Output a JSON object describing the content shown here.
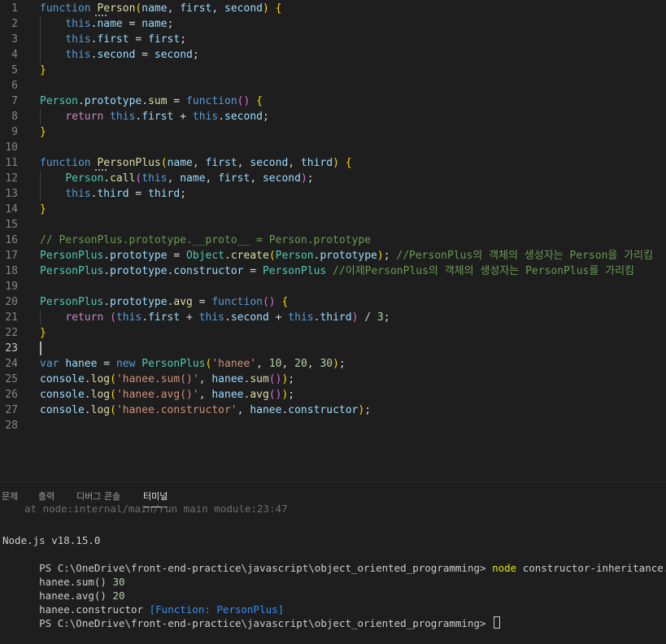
{
  "editor": {
    "lines": [
      {
        "n": "1",
        "tokens": [
          [
            "function",
            "kw"
          ],
          [
            " ",
            "pun"
          ],
          [
            "Person",
            "fn"
          ],
          [
            "(",
            "br1"
          ],
          [
            "name",
            "var"
          ],
          [
            ", ",
            "pun"
          ],
          [
            "first",
            "var"
          ],
          [
            ", ",
            "pun"
          ],
          [
            "second",
            "var"
          ],
          [
            ")",
            "br1"
          ],
          [
            " ",
            "pun"
          ],
          [
            "{",
            "br1"
          ]
        ]
      },
      {
        "n": "2",
        "tokens": [
          [
            "    ",
            "pun"
          ],
          [
            "this",
            "kw"
          ],
          [
            ".",
            "pun"
          ],
          [
            "name",
            "var"
          ],
          [
            " = ",
            "pun"
          ],
          [
            "name",
            "var"
          ],
          [
            ";",
            "pun"
          ]
        ]
      },
      {
        "n": "3",
        "tokens": [
          [
            "    ",
            "pun"
          ],
          [
            "this",
            "kw"
          ],
          [
            ".",
            "pun"
          ],
          [
            "first",
            "var"
          ],
          [
            " = ",
            "pun"
          ],
          [
            "first",
            "var"
          ],
          [
            ";",
            "pun"
          ]
        ]
      },
      {
        "n": "4",
        "tokens": [
          [
            "    ",
            "pun"
          ],
          [
            "this",
            "kw"
          ],
          [
            ".",
            "pun"
          ],
          [
            "second",
            "var"
          ],
          [
            " = ",
            "pun"
          ],
          [
            "second",
            "var"
          ],
          [
            ";",
            "pun"
          ]
        ]
      },
      {
        "n": "5",
        "tokens": [
          [
            "}",
            "br1"
          ]
        ]
      },
      {
        "n": "6",
        "tokens": []
      },
      {
        "n": "7",
        "tokens": [
          [
            "Person",
            "cls"
          ],
          [
            ".",
            "pun"
          ],
          [
            "prototype",
            "var"
          ],
          [
            ".",
            "pun"
          ],
          [
            "sum",
            "fn"
          ],
          [
            " = ",
            "pun"
          ],
          [
            "function",
            "kw"
          ],
          [
            "()",
            "br2"
          ],
          [
            " ",
            "pun"
          ],
          [
            "{",
            "br1"
          ]
        ]
      },
      {
        "n": "8",
        "tokens": [
          [
            "    ",
            "pun"
          ],
          [
            "return",
            "ctl"
          ],
          [
            " ",
            "pun"
          ],
          [
            "this",
            "kw"
          ],
          [
            ".",
            "pun"
          ],
          [
            "first",
            "var"
          ],
          [
            " + ",
            "pun"
          ],
          [
            "this",
            "kw"
          ],
          [
            ".",
            "pun"
          ],
          [
            "second",
            "var"
          ],
          [
            ";",
            "pun"
          ]
        ]
      },
      {
        "n": "9",
        "tokens": [
          [
            "}",
            "br1"
          ]
        ]
      },
      {
        "n": "10",
        "tokens": []
      },
      {
        "n": "11",
        "tokens": [
          [
            "function",
            "kw"
          ],
          [
            " ",
            "pun"
          ],
          [
            "PersonPlus",
            "fn"
          ],
          [
            "(",
            "br1"
          ],
          [
            "name",
            "var"
          ],
          [
            ", ",
            "pun"
          ],
          [
            "first",
            "var"
          ],
          [
            ", ",
            "pun"
          ],
          [
            "second",
            "var"
          ],
          [
            ", ",
            "pun"
          ],
          [
            "third",
            "var"
          ],
          [
            ")",
            "br1"
          ],
          [
            " ",
            "pun"
          ],
          [
            "{",
            "br1"
          ]
        ]
      },
      {
        "n": "12",
        "tokens": [
          [
            "    ",
            "pun"
          ],
          [
            "Person",
            "cls"
          ],
          [
            ".",
            "pun"
          ],
          [
            "call",
            "fn"
          ],
          [
            "(",
            "br2"
          ],
          [
            "this",
            "kw"
          ],
          [
            ", ",
            "pun"
          ],
          [
            "name",
            "var"
          ],
          [
            ", ",
            "pun"
          ],
          [
            "first",
            "var"
          ],
          [
            ", ",
            "pun"
          ],
          [
            "second",
            "var"
          ],
          [
            ")",
            "br2"
          ],
          [
            ";",
            "pun"
          ]
        ]
      },
      {
        "n": "13",
        "tokens": [
          [
            "    ",
            "pun"
          ],
          [
            "this",
            "kw"
          ],
          [
            ".",
            "pun"
          ],
          [
            "third",
            "var"
          ],
          [
            " = ",
            "pun"
          ],
          [
            "third",
            "var"
          ],
          [
            ";",
            "pun"
          ]
        ]
      },
      {
        "n": "14",
        "tokens": [
          [
            "}",
            "br1"
          ]
        ]
      },
      {
        "n": "15",
        "tokens": []
      },
      {
        "n": "16",
        "tokens": [
          [
            "// PersonPlus.prototype.__proto__ = Person.prototype",
            "cm"
          ]
        ]
      },
      {
        "n": "17",
        "tokens": [
          [
            "PersonPlus",
            "cls"
          ],
          [
            ".",
            "pun"
          ],
          [
            "prototype",
            "var"
          ],
          [
            " = ",
            "pun"
          ],
          [
            "Object",
            "cls"
          ],
          [
            ".",
            "pun"
          ],
          [
            "create",
            "fn"
          ],
          [
            "(",
            "br1"
          ],
          [
            "Person",
            "cls"
          ],
          [
            ".",
            "pun"
          ],
          [
            "prototype",
            "var"
          ],
          [
            ")",
            "br1"
          ],
          [
            "; ",
            "pun"
          ],
          [
            "//PersonPlus의 객체의 생성자는 Person을 가리킴",
            "cm"
          ]
        ]
      },
      {
        "n": "18",
        "tokens": [
          [
            "PersonPlus",
            "cls"
          ],
          [
            ".",
            "pun"
          ],
          [
            "prototype",
            "var"
          ],
          [
            ".",
            "pun"
          ],
          [
            "constructor",
            "var"
          ],
          [
            " = ",
            "pun"
          ],
          [
            "PersonPlus",
            "cls"
          ],
          [
            " ",
            "pun"
          ],
          [
            "//이제PersonPlus의 객체의 생성자는 PersonPlus를 가리킴",
            "cm"
          ]
        ]
      },
      {
        "n": "19",
        "tokens": []
      },
      {
        "n": "20",
        "tokens": [
          [
            "PersonPlus",
            "cls"
          ],
          [
            ".",
            "pun"
          ],
          [
            "prototype",
            "var"
          ],
          [
            ".",
            "pun"
          ],
          [
            "avg",
            "fn"
          ],
          [
            " = ",
            "pun"
          ],
          [
            "function",
            "kw"
          ],
          [
            "()",
            "br2"
          ],
          [
            " ",
            "pun"
          ],
          [
            "{",
            "br1"
          ]
        ]
      },
      {
        "n": "21",
        "tokens": [
          [
            "    ",
            "pun"
          ],
          [
            "return",
            "ctl"
          ],
          [
            " ",
            "pun"
          ],
          [
            "(",
            "br2"
          ],
          [
            "this",
            "kw"
          ],
          [
            ".",
            "pun"
          ],
          [
            "first",
            "var"
          ],
          [
            " + ",
            "pun"
          ],
          [
            "this",
            "kw"
          ],
          [
            ".",
            "pun"
          ],
          [
            "second",
            "var"
          ],
          [
            " + ",
            "pun"
          ],
          [
            "this",
            "kw"
          ],
          [
            ".",
            "pun"
          ],
          [
            "third",
            "var"
          ],
          [
            ")",
            "br2"
          ],
          [
            " / ",
            "pun"
          ],
          [
            "3",
            "num"
          ],
          [
            ";",
            "pun"
          ]
        ]
      },
      {
        "n": "22",
        "tokens": [
          [
            "}",
            "br1"
          ]
        ]
      },
      {
        "n": "23",
        "tokens": []
      },
      {
        "n": "24",
        "tokens": [
          [
            "var",
            "kw"
          ],
          [
            " ",
            "pun"
          ],
          [
            "hanee",
            "var"
          ],
          [
            " = ",
            "pun"
          ],
          [
            "new",
            "kw"
          ],
          [
            " ",
            "pun"
          ],
          [
            "PersonPlus",
            "cls"
          ],
          [
            "(",
            "br1"
          ],
          [
            "'hanee'",
            "str"
          ],
          [
            ", ",
            "pun"
          ],
          [
            "10",
            "num"
          ],
          [
            ", ",
            "pun"
          ],
          [
            "20",
            "num"
          ],
          [
            ", ",
            "pun"
          ],
          [
            "30",
            "num"
          ],
          [
            ")",
            "br1"
          ],
          [
            ";",
            "pun"
          ]
        ]
      },
      {
        "n": "25",
        "tokens": [
          [
            "console",
            "var"
          ],
          [
            ".",
            "pun"
          ],
          [
            "log",
            "fn"
          ],
          [
            "(",
            "br1"
          ],
          [
            "'hanee.sum()'",
            "str"
          ],
          [
            ", ",
            "pun"
          ],
          [
            "hanee",
            "var"
          ],
          [
            ".",
            "pun"
          ],
          [
            "sum",
            "fn"
          ],
          [
            "()",
            "br2"
          ],
          [
            ")",
            "br1"
          ],
          [
            ";",
            "pun"
          ]
        ]
      },
      {
        "n": "26",
        "tokens": [
          [
            "console",
            "var"
          ],
          [
            ".",
            "pun"
          ],
          [
            "log",
            "fn"
          ],
          [
            "(",
            "br1"
          ],
          [
            "'hanee.avg()'",
            "str"
          ],
          [
            ", ",
            "pun"
          ],
          [
            "hanee",
            "var"
          ],
          [
            ".",
            "pun"
          ],
          [
            "avg",
            "fn"
          ],
          [
            "()",
            "br2"
          ],
          [
            ")",
            "br1"
          ],
          [
            ";",
            "pun"
          ]
        ]
      },
      {
        "n": "27",
        "tokens": [
          [
            "console",
            "var"
          ],
          [
            ".",
            "pun"
          ],
          [
            "log",
            "fn"
          ],
          [
            "(",
            "br1"
          ],
          [
            "'hanee.constructor'",
            "str"
          ],
          [
            ", ",
            "pun"
          ],
          [
            "hanee",
            "var"
          ],
          [
            ".",
            "pun"
          ],
          [
            "constructor",
            "var"
          ],
          [
            ")",
            "br1"
          ],
          [
            ";",
            "pun"
          ]
        ]
      },
      {
        "n": "28",
        "tokens": []
      }
    ],
    "active_line": "23"
  },
  "panel": {
    "tabs": [
      "문제",
      "출력",
      "디버그 콘솔",
      "터미널"
    ],
    "active_tab": "터미널"
  },
  "terminal": {
    "clipped_line": "at node:internal/main/run_main_module:23:47",
    "node_version": "Node.js v18.15.0",
    "prompt1": "PS C:\\OneDrive\\front-end-practice\\javascript\\object_oriented_programming> ",
    "cmd_name": "node",
    "cmd_arg": " constructor-inheritance.js",
    "out1_label": "hanee.sum() ",
    "out1_value": "30",
    "out2_label": "hanee.avg() ",
    "out2_value": "20",
    "out3_label": "hanee.constructor ",
    "out3_value": "[Function: PersonPlus]",
    "prompt2": "PS C:\\OneDrive\\front-end-practice\\javascript\\object_oriented_programming> "
  }
}
